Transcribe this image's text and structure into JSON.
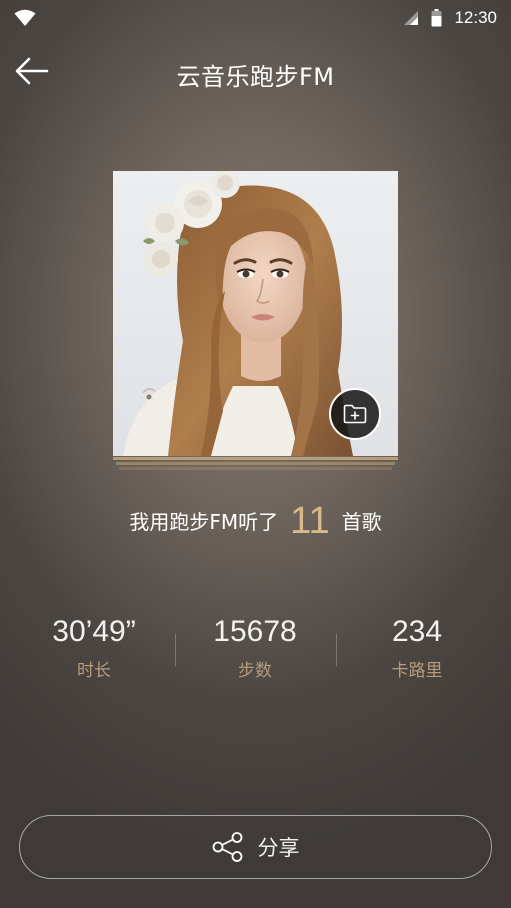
{
  "status_bar": {
    "time": "12:30",
    "icons": [
      "wifi-icon",
      "signal-icon",
      "battery-icon"
    ]
  },
  "header": {
    "back_icon": "arrow-left-icon",
    "title": "云音乐跑步FM"
  },
  "album": {
    "add_icon": "folder-add-icon"
  },
  "summary": {
    "prefix": "我用跑步FM听了",
    "count": "11",
    "suffix": "首歌"
  },
  "stats": [
    {
      "value": "30’49”",
      "label": "时长"
    },
    {
      "value": "15678",
      "label": "步数"
    },
    {
      "value": "234",
      "label": "卡路里"
    }
  ],
  "share": {
    "icon": "share-icon",
    "label": "分享"
  },
  "colors": {
    "accent": "#d9b98a",
    "stat_label": "#b59d7c",
    "background": "#6e655d"
  }
}
